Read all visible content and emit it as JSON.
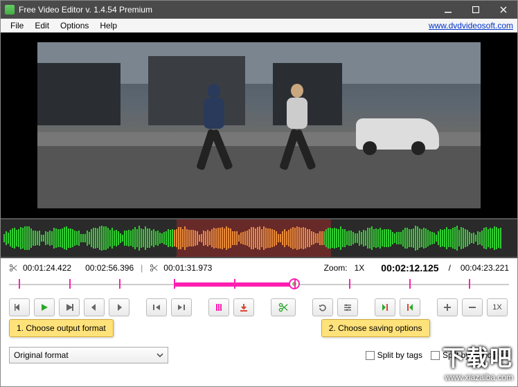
{
  "window": {
    "title": "Free Video Editor v. 1.4.54 Premium"
  },
  "menu": {
    "file": "File",
    "edit": "Edit",
    "options": "Options",
    "help": "Help",
    "link": "www.dvdvideosoft.com"
  },
  "markers": {
    "start": "00:01:24.422",
    "end": "00:02:56.396",
    "duration": "00:01:31.973"
  },
  "zoom": {
    "label": "Zoom:",
    "value": "1X"
  },
  "time": {
    "current": "00:02:12.125",
    "total": "00:04:23.221"
  },
  "hints": {
    "h1": "1. Choose output format",
    "h2": "2. Choose saving options"
  },
  "format": {
    "selected": "Original format"
  },
  "checks": {
    "tags": "Split by tags",
    "selections": "Split by selections"
  },
  "toolbar": {
    "btn_1x": "1X"
  },
  "watermark": {
    "big": "下载吧",
    "small": "www.xiazaiba.com"
  }
}
